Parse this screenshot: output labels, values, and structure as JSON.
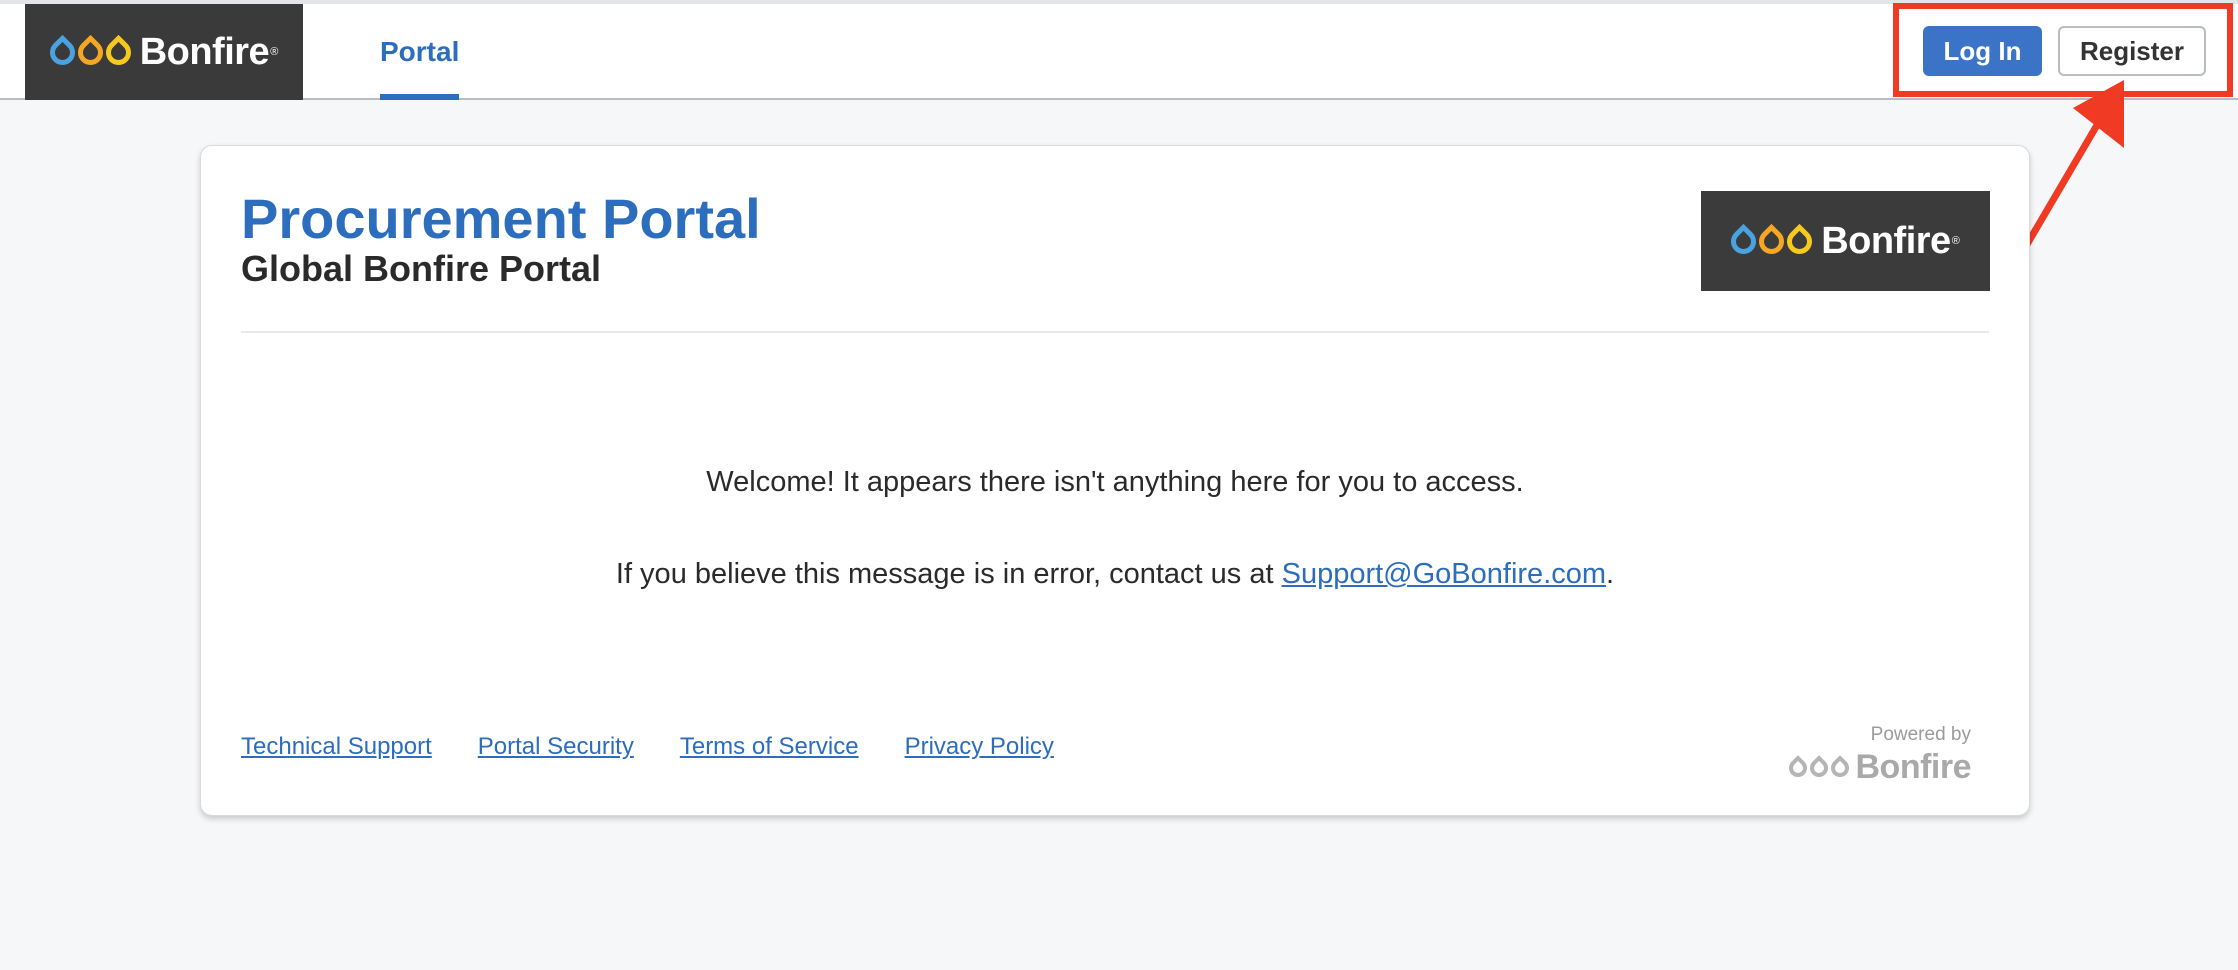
{
  "header": {
    "brand": "Bonfire",
    "brand_mark": "®",
    "nav_portal": "Portal",
    "login_label": "Log In",
    "register_label": "Register"
  },
  "card": {
    "title": "Procurement Portal",
    "subtitle": "Global Bonfire Portal",
    "logo_text": "Bonfire",
    "logo_mark": "®",
    "welcome": "Welcome! It appears there isn't anything here for you to access.",
    "error_prefix": "If you believe this message is in error, contact us at ",
    "support_email": "Support@GoBonfire.com",
    "error_suffix": "."
  },
  "footer": {
    "links": [
      "Technical Support",
      "Portal Security",
      "Terms of Service",
      "Privacy Policy"
    ],
    "powered_by": "Powered by",
    "powered_brand": "Bonfire"
  },
  "colors": {
    "accent": "#2c6dbd",
    "annotation": "#f03a24",
    "drop_blue": "#4aa3df",
    "drop_orange": "#f5a623",
    "drop_yellow": "#f7c81e"
  }
}
